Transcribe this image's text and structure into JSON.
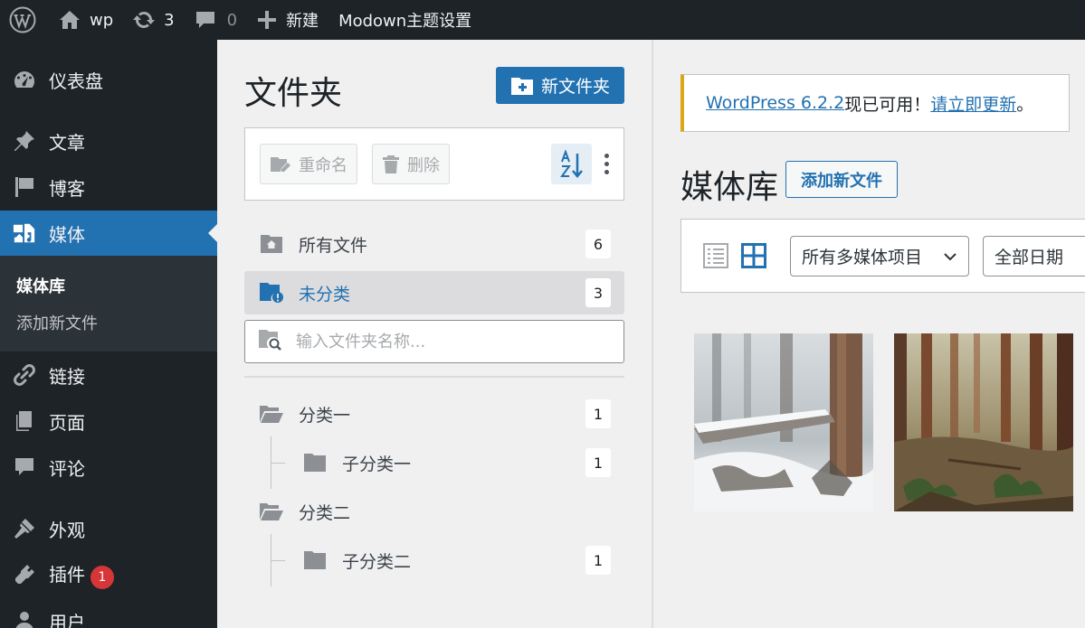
{
  "adminbar": {
    "site_name": "wp",
    "updates_count": "3",
    "comments_count": "0",
    "new_label": "新建",
    "theme_settings": "Modown主题设置"
  },
  "sidebar": {
    "items": [
      {
        "label": "仪表盘",
        "icon": "dashboard-icon"
      },
      {
        "label": "文章",
        "icon": "pin-icon"
      },
      {
        "label": "博客",
        "icon": "flag-icon"
      },
      {
        "label": "媒体",
        "icon": "media-icon"
      },
      {
        "label": "链接",
        "icon": "link-icon"
      },
      {
        "label": "页面",
        "icon": "page-icon"
      },
      {
        "label": "评论",
        "icon": "comment-icon"
      },
      {
        "label": "外观",
        "icon": "brush-icon"
      },
      {
        "label": "插件",
        "icon": "plugin-icon",
        "badge": "1"
      },
      {
        "label": "用户",
        "icon": "user-icon"
      }
    ],
    "submenu": [
      "媒体库",
      "添加新文件"
    ]
  },
  "folders": {
    "title": "文件夹",
    "new_folder": "新文件夹",
    "rename": "重命名",
    "delete": "删除",
    "all_files": {
      "label": "所有文件",
      "count": "6"
    },
    "uncategorized": {
      "label": "未分类",
      "count": "3"
    },
    "search_placeholder": "输入文件夹名称...",
    "tree": [
      {
        "label": "分类一",
        "count": "1"
      },
      {
        "label": "子分类一",
        "count": "1"
      },
      {
        "label": "分类二",
        "count": null
      },
      {
        "label": "子分类二",
        "count": "1"
      }
    ]
  },
  "main": {
    "notice_link": "WordPress 6.2.2",
    "notice_text": "现已可用！",
    "notice_update": "请立即更新",
    "notice_end": "。",
    "title": "媒体库",
    "add_new": "添加新文件",
    "filter_type": "所有多媒体项目",
    "filter_date": "全部日期"
  },
  "colors": {
    "accent": "#2271b1",
    "adminbar_bg": "#1d2327",
    "notice_warning": "#dba617",
    "badge": "#d63638"
  }
}
